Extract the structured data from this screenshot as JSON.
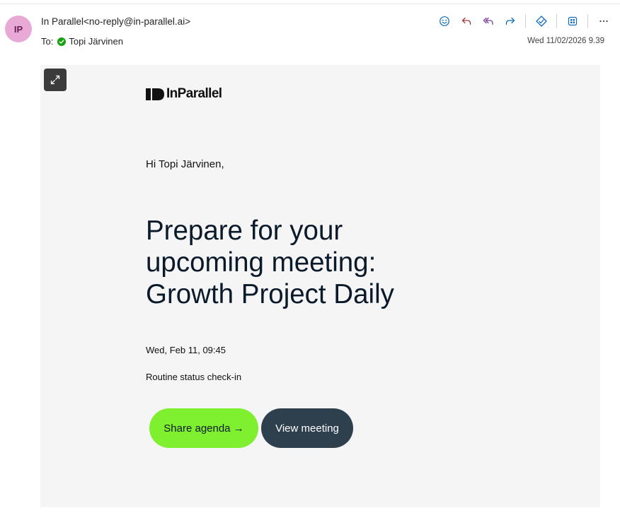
{
  "header": {
    "avatar_initials": "IP",
    "avatar_color": "#e8a9d6",
    "sender_name": "In Parallel",
    "sender_email": "<no-reply@in-parallel.ai>",
    "to_label": "To:",
    "to_name": "Topi Järvinen",
    "date": "Wed 11/02/2026 9.39",
    "actions": [
      "emoji-icon",
      "reply-icon",
      "reply-all-icon",
      "forward-icon",
      "copilot-icon",
      "apps-icon",
      "more-icon"
    ],
    "accent_color": "#0f6cbd"
  },
  "email": {
    "logo_text": "InParallel",
    "greeting": "Hi Topi Järvinen,",
    "headline": "Prepare for your upcoming meeting: Growth Project Daily",
    "datetime": "Wed, Feb 11, 09:45",
    "description": "Routine status check-in",
    "share_button": "Share agenda →",
    "view_button": "View meeting",
    "share_color": "#7ff02f",
    "view_color": "#2e3f4e"
  }
}
